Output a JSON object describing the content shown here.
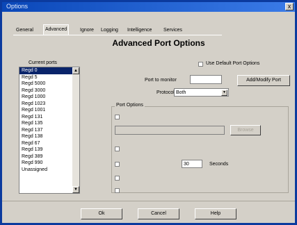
{
  "window": {
    "title": "Options",
    "close": "x"
  },
  "tabs": [
    "General",
    "Advanced",
    "Ignore",
    "Logging",
    "Intelligence",
    "Services"
  ],
  "heading": "Advanced Port Options",
  "current_ports_label": "Current ports",
  "ports": [
    "Regd 0",
    "Regd 5",
    "Regd 5000",
    "Regd 3000",
    "Regd 1000",
    "Regd 1023",
    "Regd 1001",
    "Regd 131",
    "Regd 135",
    "Regd 137",
    "Regd 138",
    "Regd 67",
    "Regd 139",
    "Regd 389",
    "Regd 990",
    "Unassigned"
  ],
  "use_default_label": "Use Default Port Options",
  "port_number_label": "Port to monitor",
  "port_number_value": "",
  "protocol_label": "Protocol",
  "protocol_value": "Both",
  "add_modify_label": "Add/Modify Port",
  "port_options_label": "Port Options",
  "browse_label": "Browse",
  "seconds_value": "30",
  "seconds_label": "Seconds",
  "buttons": {
    "ok": "Ok",
    "cancel": "Cancel",
    "help": "Help"
  }
}
